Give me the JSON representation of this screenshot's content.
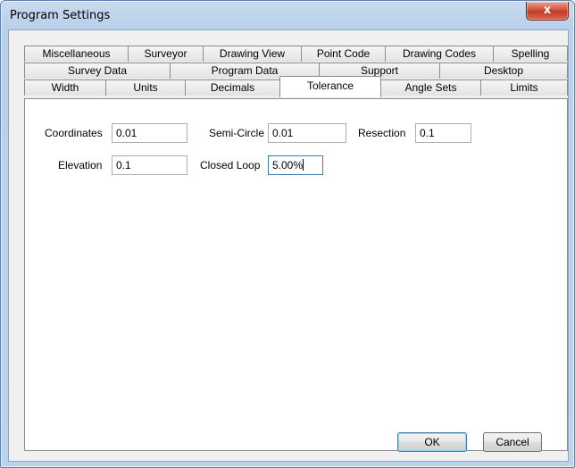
{
  "window": {
    "title": "Program Settings",
    "close_glyph": "x"
  },
  "tabs": {
    "row1": [
      "Miscellaneous",
      "Surveyor",
      "Drawing View",
      "Point Code",
      "Drawing Codes",
      "Spelling"
    ],
    "row2": [
      "Survey Data",
      "Program Data",
      "Support",
      "Desktop"
    ],
    "row3": [
      "Width",
      "Units",
      "Decimals",
      "Tolerance",
      "Angle Sets",
      "Limits"
    ],
    "active": "Tolerance"
  },
  "fields": {
    "coordinates": {
      "label": "Coordinates",
      "value": "0.01"
    },
    "semi_circle": {
      "label": "Semi-Circle",
      "value": "0.01"
    },
    "resection": {
      "label": "Resection",
      "value": "0.1"
    },
    "elevation": {
      "label": "Elevation",
      "value": "0.1"
    },
    "closed_loop": {
      "label": "Closed Loop",
      "value": "5.00%"
    }
  },
  "buttons": {
    "ok": "OK",
    "cancel": "Cancel"
  }
}
